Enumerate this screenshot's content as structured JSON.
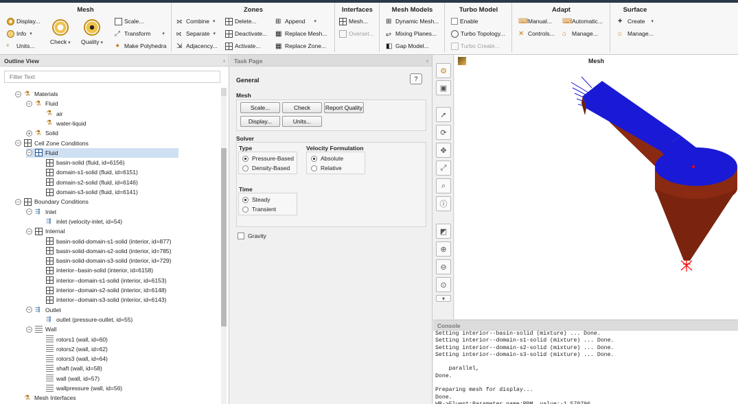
{
  "ribbon": {
    "mesh": {
      "title": "Mesh",
      "display": "Display...",
      "info": "Info",
      "units": "Units...",
      "check": "Check",
      "quality": "Quality",
      "scale": "Scale...",
      "transform": "Transform",
      "make_polyhedra": "Make Polyhedra"
    },
    "zones": {
      "title": "Zones",
      "combine": "Combine",
      "separate": "Separate",
      "adjacency": "Adjacency...",
      "delete": "Delete...",
      "deactivate": "Deactivate...",
      "activate": "Activate...",
      "append": "Append",
      "replace_mesh": "Replace Mesh...",
      "replace_zone": "Replace Zone..."
    },
    "interfaces": {
      "title": "Interfaces",
      "mesh": "Mesh...",
      "overset": "Overset..."
    },
    "mesh_models": {
      "title": "Mesh Models",
      "dynamic_mesh": "Dynamic Mesh...",
      "mixing_planes": "Mixing Planes...",
      "gap_model": "Gap Model..."
    },
    "turbo_model": {
      "title": "Turbo Model",
      "enable": "Enable",
      "turbo_topology": "Turbo Topology...",
      "turbo_create": "Turbo Create..."
    },
    "adapt": {
      "title": "Adapt",
      "manual": "Manual...",
      "automatic": "Automatic...",
      "controls": "Controls...",
      "manage": "Manage..."
    },
    "surface": {
      "title": "Surface",
      "create": "Create",
      "manage": "Manage..."
    }
  },
  "outline": {
    "title": "Outline View",
    "filter_placeholder": "Filter Text",
    "nodes": [
      {
        "label": "Materials",
        "toggle": "⊖",
        "icon": "materials"
      },
      {
        "label": "Fluid",
        "toggle": "⊖",
        "icon": "materials"
      },
      {
        "label": "air",
        "icon": "material"
      },
      {
        "label": "water-liquid",
        "icon": "material"
      },
      {
        "label": "Solid",
        "toggle": "⊕",
        "icon": "materials"
      },
      {
        "label": "Cell Zone Conditions",
        "toggle": "⊖",
        "icon": "grid"
      },
      {
        "label": "Fluid",
        "toggle": "⊖",
        "icon": "grid",
        "selected": true
      },
      {
        "label": "basin-solid (fluid, id=6156)",
        "icon": "grid"
      },
      {
        "label": "domain-s1-solid (fluid, id=6151)",
        "icon": "grid"
      },
      {
        "label": "domain-s2-solid (fluid, id=6146)",
        "icon": "grid"
      },
      {
        "label": "domain-s3-solid (fluid, id=6141)",
        "icon": "grid"
      },
      {
        "label": "Boundary Conditions",
        "toggle": "⊖",
        "icon": "grid"
      },
      {
        "label": "Inlet",
        "toggle": "⊖",
        "icon": "inlet"
      },
      {
        "label": "inlet (velocity-inlet, id=54)",
        "icon": "inlet"
      },
      {
        "label": "Internal",
        "toggle": "⊖",
        "icon": "grid"
      },
      {
        "label": "basin-solid-domain-s1-solid (interior, id=877)",
        "icon": "grid"
      },
      {
        "label": "basin-solid-domain-s2-solid (interior, id=785)",
        "icon": "grid"
      },
      {
        "label": "basin-solid-domain-s3-solid (interior, id=729)",
        "icon": "grid"
      },
      {
        "label": "interior--basin-solid (interior, id=6158)",
        "icon": "grid"
      },
      {
        "label": "interior--domain-s1-solid (interior, id=6153)",
        "icon": "grid"
      },
      {
        "label": "interior--domain-s2-solid (interior, id=6148)",
        "icon": "grid"
      },
      {
        "label": "interior--domain-s3-solid (interior, id=6143)",
        "icon": "grid"
      },
      {
        "label": "Outlet",
        "toggle": "⊖",
        "icon": "inlet"
      },
      {
        "label": "outlet (pressure-outlet, id=55)",
        "icon": "inlet"
      },
      {
        "label": "Wall",
        "toggle": "⊖",
        "icon": "wall"
      },
      {
        "label": "rotors1 (wall, id=60)",
        "icon": "wall"
      },
      {
        "label": "rotors2 (wall, id=62)",
        "icon": "wall"
      },
      {
        "label": "rotors3 (wall, id=64)",
        "icon": "wall"
      },
      {
        "label": "shaft (wall, id=58)",
        "icon": "wall"
      },
      {
        "label": "wall (wall, id=57)",
        "icon": "wall"
      },
      {
        "label": "wallpressure (wall, id=56)",
        "icon": "wall"
      },
      {
        "label": "Mesh Interfaces",
        "icon": "materials"
      }
    ]
  },
  "task": {
    "title": "Task Page",
    "heading": "General",
    "help": "?",
    "mesh_section": "Mesh",
    "scale_btn": "Scale...",
    "check_btn": "Check",
    "report_quality_btn": "Report Quality",
    "display_btn": "Display...",
    "units_btn": "Units...",
    "solver_section": "Solver",
    "type_label": "Type",
    "pressure_based": "Pressure-Based",
    "density_based": "Density-Based",
    "velocity_formulation_label": "Velocity Formulation",
    "absolute": "Absolute",
    "relative": "Relative",
    "time_label": "Time",
    "steady": "Steady",
    "transient": "Transient",
    "gravity": "Gravity"
  },
  "viewport": {
    "title": "Mesh",
    "colors": {
      "top": "#1a1ad6",
      "side": "#8b2a12",
      "point": "#ff0000"
    }
  },
  "console": {
    "title": "Console",
    "lines": [
      "Setting interior--basin-solid (mixture) ... Done.",
      "Setting interior--domain-s1-solid (mixture) ... Done.",
      "Setting interior--domain-s2-solid (mixture) ... Done.",
      "Setting interior--domain-s3-solid (mixture) ... Done.",
      "",
      "    parallel,",
      "Done.",
      "",
      "Preparing mesh for display...",
      "Done.",
      "WB->Fluent:Parameter name:RPM, value:-1.570796"
    ]
  }
}
